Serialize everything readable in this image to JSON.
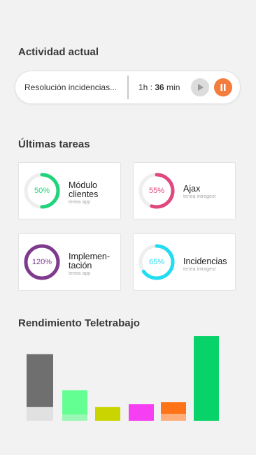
{
  "activity": {
    "title": "Actividad actual",
    "task": "Resolución incidencias...",
    "hours": "1h : ",
    "minutes": "36",
    "unit": " min"
  },
  "tasks": {
    "title": "Últimas tareas",
    "items": [
      {
        "percent_label": "50%",
        "percent": 50,
        "name": "Módulo clientes",
        "sub": "tenea app",
        "color": "#1fd47a"
      },
      {
        "percent_label": "55%",
        "percent": 55,
        "name": "Ajax",
        "sub": "tenea intragest",
        "color": "#e0497f"
      },
      {
        "percent_label": "120%",
        "percent": 120,
        "name": "Implemen-tación",
        "sub": "tenea app",
        "color": "#7e3b8e"
      },
      {
        "percent_label": "65%",
        "percent": 65,
        "name": "Incidencias",
        "sub": "tenea intragest",
        "color": "#22dcf2"
      }
    ]
  },
  "chart": {
    "title": "Rendimiento Teletrabajo"
  },
  "chart_data": {
    "type": "bar",
    "categories": [
      "",
      "",
      "",
      "",
      "",
      ""
    ],
    "series": [
      {
        "values": [
          20,
          9,
          0,
          0,
          10,
          0
        ],
        "colors": [
          "#e1e1e1",
          "#9af7b5",
          "#c9d400",
          "#f63ef3",
          "#ffae7a",
          "#07d368"
        ]
      },
      {
        "values": [
          76,
          35,
          20,
          24,
          17,
          122
        ],
        "colors": [
          "#6f6f6f",
          "#63ff93",
          "#c9d400",
          "#f63ef3",
          "#ff7318",
          "#07d368"
        ]
      }
    ],
    "ylim": [
      0,
      125
    ],
    "grid": false
  }
}
